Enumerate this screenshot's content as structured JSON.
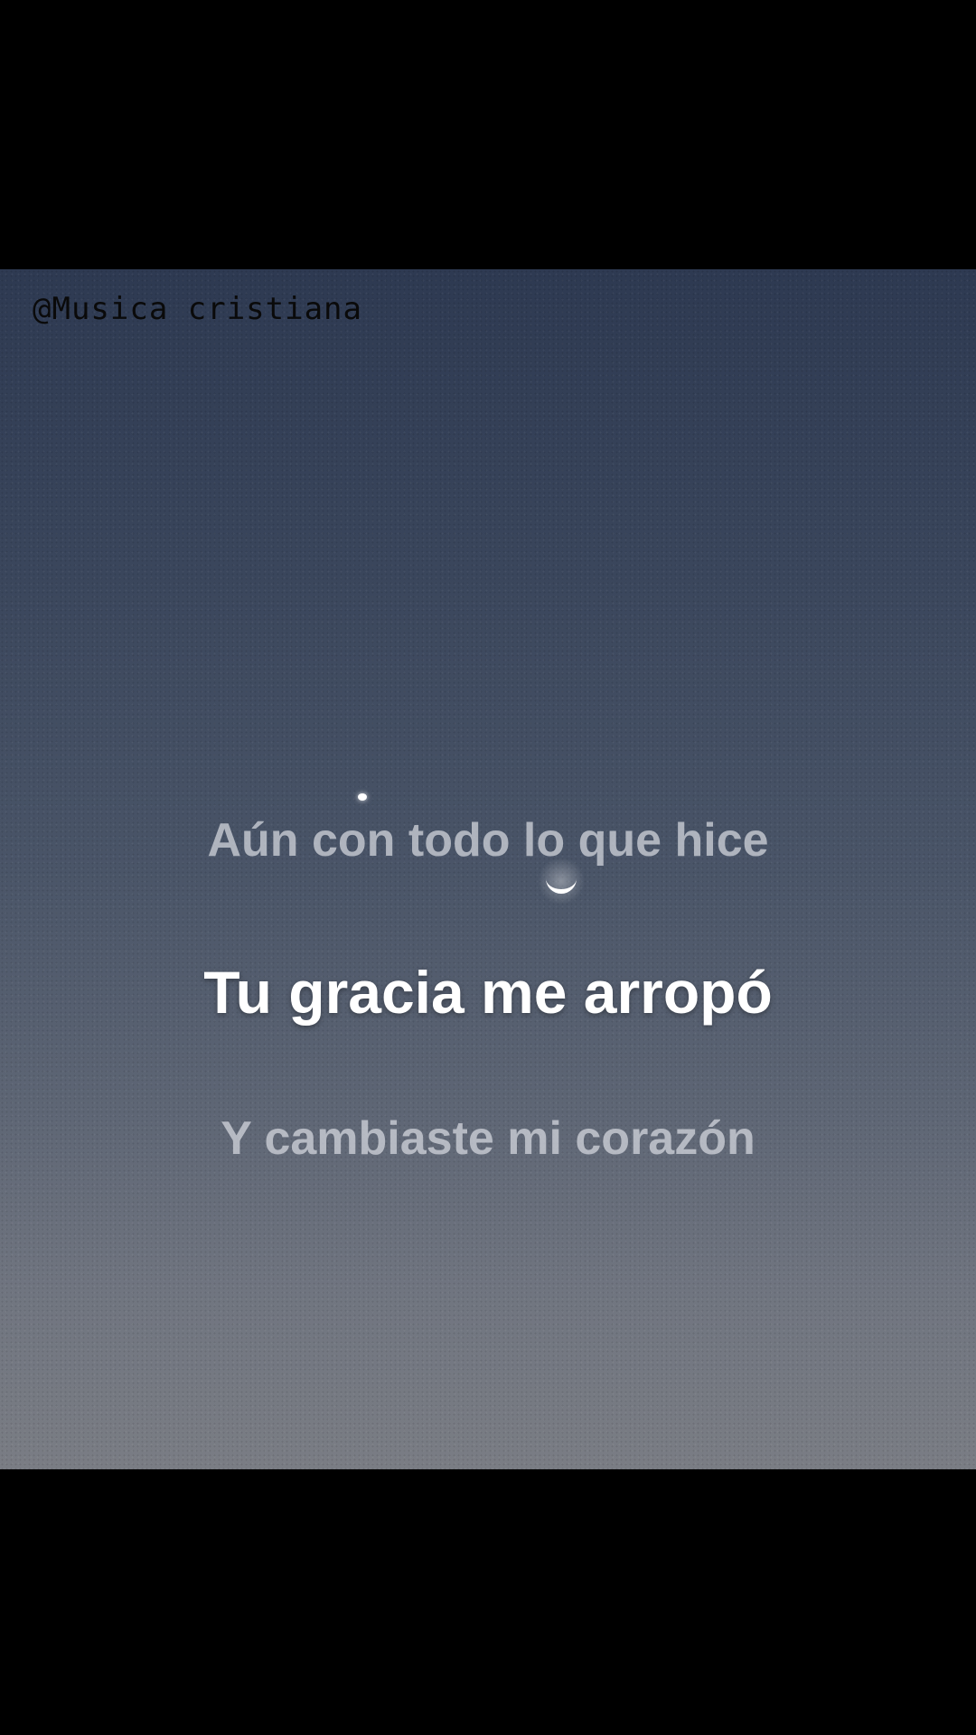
{
  "watermark": "@Musica cristiana",
  "lyrics": {
    "previous": "Aún con todo lo que hice",
    "current": "Tu gracia me arropó",
    "next": "Y cambiaste mi corazón"
  },
  "colors": {
    "letterbox": "#000000",
    "sky_top": "#2e3a52",
    "sky_bottom": "#7a7d84",
    "lyric_active": "#ffffff",
    "lyric_inactive": "#d7dae1"
  },
  "icons": {
    "moon": "crescent-moon",
    "star": "star"
  }
}
